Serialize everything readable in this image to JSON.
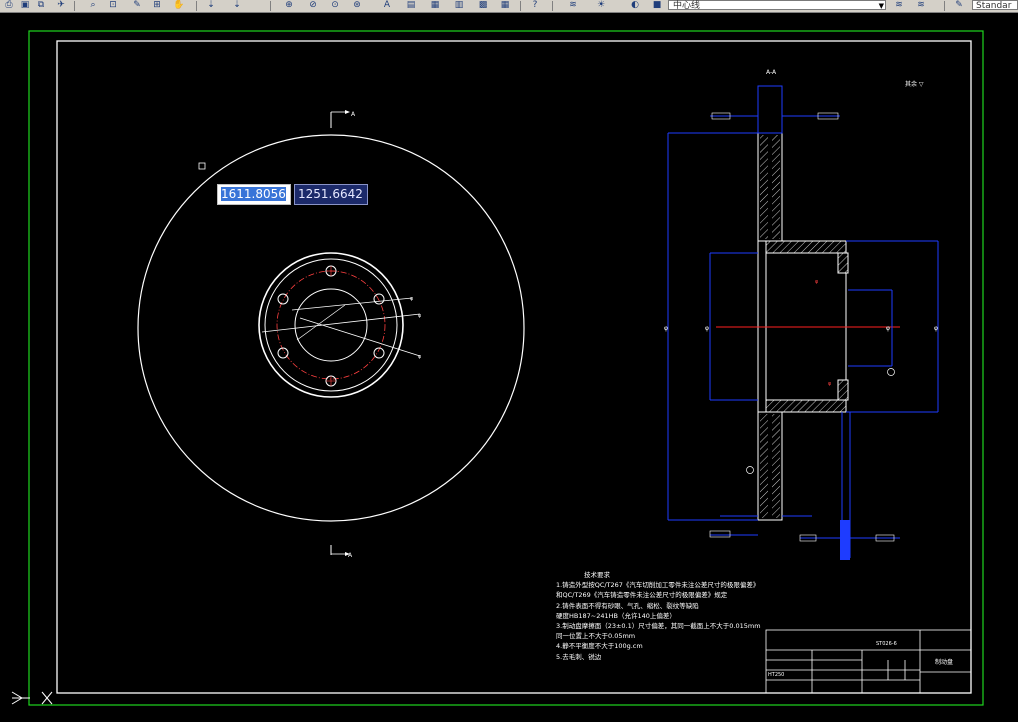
{
  "toolbar": {
    "layer_combo": "中心线",
    "style_combo": "Standar",
    "icons": [
      "print-icon",
      "print-preview-icon",
      "publish-icon",
      "zoom-realtime-icon",
      "zoom-window-icon",
      "zoom-previous-icon",
      "properties-icon",
      "design-center-icon",
      "tool-palettes-icon",
      "table-icon",
      "help-icon",
      "layer-manager-icon",
      "layer-state-icon",
      "make-layer-current-icon"
    ]
  },
  "coordinate_input": {
    "x": "1611.8056",
    "y": "1251.6642"
  },
  "drawing": {
    "section_title": "A-A",
    "section_marker_top": "A",
    "section_marker_bottom": "A",
    "roughness_note": "其余 ▽",
    "technical_requirements": {
      "heading": "技术要求",
      "lines": [
        "1.铸造外型按QC/T267《汽车切削加工零件未注公差尺寸的极限偏差》",
        "  和QC/T269《汽车铸造零件未注公差尺寸的极限偏差》规定",
        "2.铸件表面不得有砂眼、气孔、缩松、裂纹等缺陷",
        "  硬度HB187~241HB（允许140上偏差）",
        "3.制动盘摩擦面（23±0.1）尺寸偏差，其同一截面上不大于0.015mm",
        "  同一位置上不大于0.05mm",
        "4.静不平衡度不大于100g.cm",
        "5.去毛刺、锐边"
      ]
    },
    "title_block": {
      "part_no": "ST026-6",
      "part_name": "制动盘",
      "material": "HT250"
    }
  }
}
